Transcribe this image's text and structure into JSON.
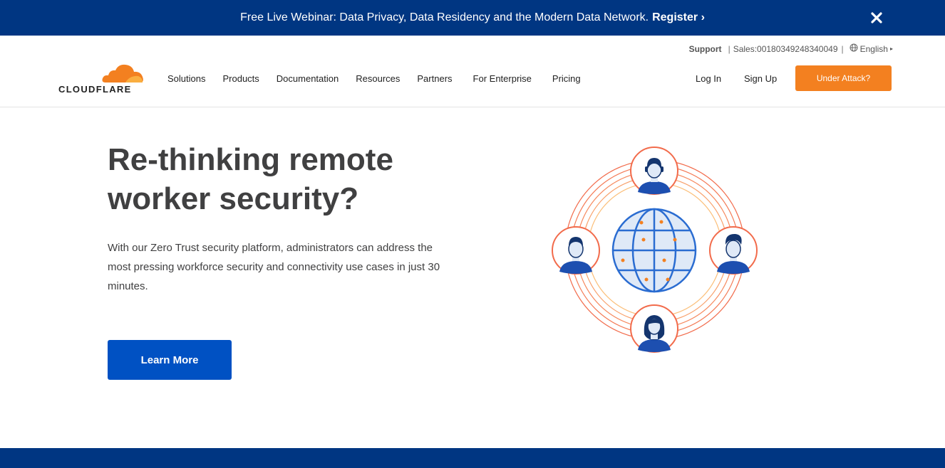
{
  "banner": {
    "text": "Free Live Webinar: Data Privacy, Data Residency and the Modern Data Network.",
    "register_label": "Register ›"
  },
  "utility": {
    "support": "Support",
    "sales": "Sales:00180349248340049",
    "language": "English"
  },
  "logo": {
    "text": "CLOUDFLARE"
  },
  "nav": [
    "Solutions",
    "Products",
    "Documentation",
    "Resources",
    "Partners",
    "For Enterprise",
    "Pricing"
  ],
  "header": {
    "login": "Log In",
    "signup": "Sign Up",
    "attack": "Under Attack?"
  },
  "hero": {
    "title_line1": "Re-thinking remote",
    "title_line2": "worker security?",
    "description": "With our Zero Trust security platform, administrators can address the most pressing workforce security and connectivity use cases in just 30 minutes.",
    "cta": "Learn More"
  },
  "colors": {
    "brand_blue": "#003682",
    "accent_orange": "#f38020",
    "cta_blue": "#0051c3"
  },
  "icons": [
    "close-icon",
    "globe-icon",
    "cloud-logo-icon",
    "chevron-down-icon"
  ]
}
